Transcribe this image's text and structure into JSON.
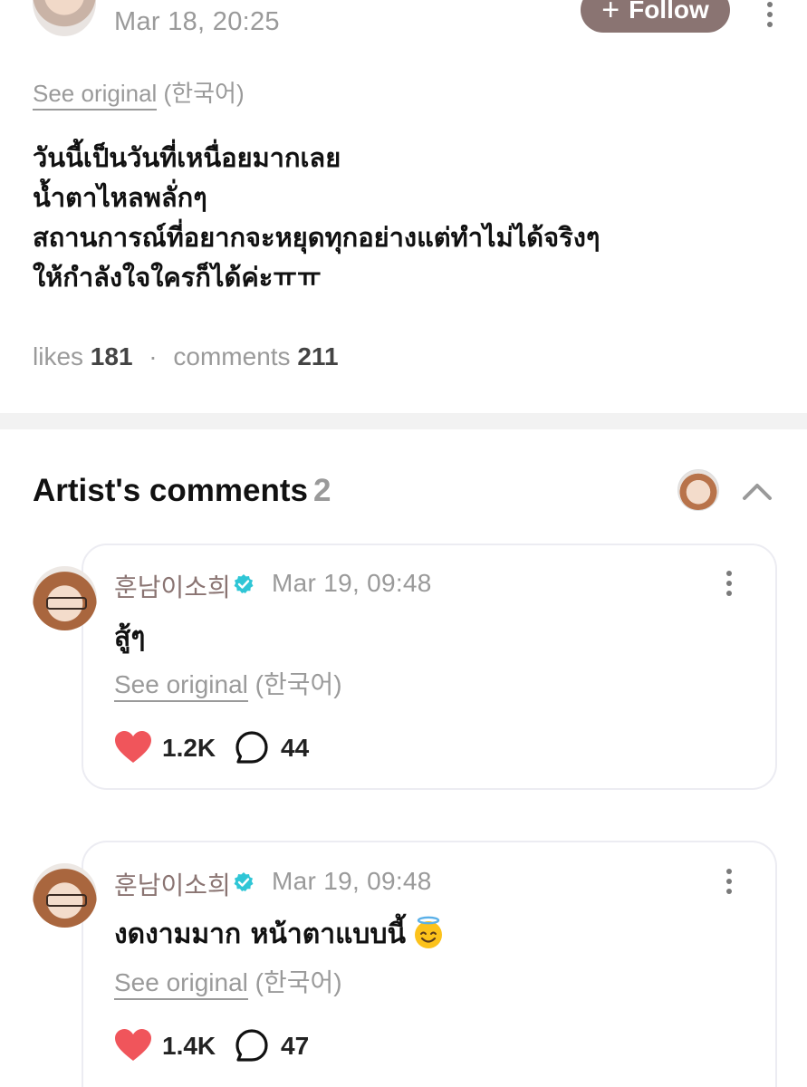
{
  "post": {
    "date": "Mar 18, 20:25",
    "follow_label": "Follow",
    "see_original": "See original",
    "language": "(한국어)",
    "body_lines": [
      "วันนี้เป็นวันที่เหนื่อยมากเลย",
      "น้ำตาไหลพลั่กๆ",
      "สถานการณ์ที่อยากจะหยุดทุกอย่างแต่ทำไม่ได้จริงๆ",
      "ให้กำลังใจใครก็ได้ค่ะㅠㅠ"
    ],
    "likes_label": "likes",
    "likes_count": "181",
    "separator": "·",
    "comments_label": "comments",
    "comments_count": "211"
  },
  "artist_comments": {
    "title": "Artist's comments",
    "count": "2",
    "items": [
      {
        "author": "훈남이소희",
        "date": "Mar 19, 09:48",
        "text": "สู้ๆ",
        "see_original": "See original",
        "language": "(한국어)",
        "likes": "1.2K",
        "replies": "44"
      },
      {
        "author": "훈남이소희",
        "date": "Mar 19, 09:48",
        "text": "งดงามมาก หน้าตาแบบนี้",
        "emoji": "smiling-face-with-halo",
        "see_original": "See original",
        "language": "(한국어)",
        "likes": "1.4K",
        "replies": "47"
      }
    ]
  },
  "colors": {
    "accent_brown": "#8a7472",
    "muted_gray": "#9a9a9a",
    "heart_red": "#f0555b",
    "verified_teal": "#2fc6d6"
  }
}
